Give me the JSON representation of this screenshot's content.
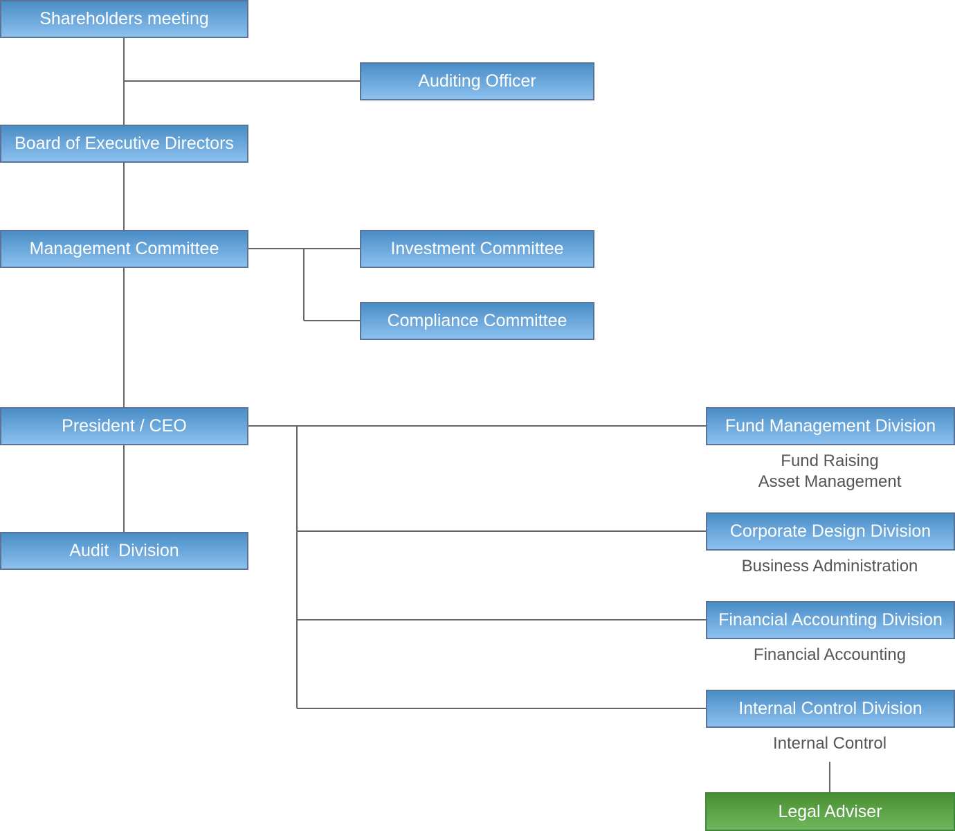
{
  "nodes": {
    "shareholders": "Shareholders meeting",
    "auditing_officer": "Auditing Officer",
    "board": "Board of Executive Directors",
    "management": "Management Committee",
    "investment": "Investment Committee",
    "compliance": "Compliance Committee",
    "president": "President / CEO",
    "audit_division": "Audit  Division",
    "fund_management": "Fund Management Division",
    "corporate_design": "Corporate Design Division",
    "financial_accounting": "Financial Accounting Division",
    "internal_control": "Internal Control Division",
    "legal_adviser": "Legal Adviser"
  },
  "subtexts": {
    "fund_management": [
      "Fund Raising",
      "Asset Management"
    ],
    "corporate_design": [
      "Business Administration"
    ],
    "financial_accounting": [
      "Financial Accounting"
    ],
    "internal_control": [
      "Internal Control"
    ]
  },
  "colors": {
    "box_blue": "#4a8ec6",
    "box_green": "#4a8e30",
    "line": "#666666"
  }
}
